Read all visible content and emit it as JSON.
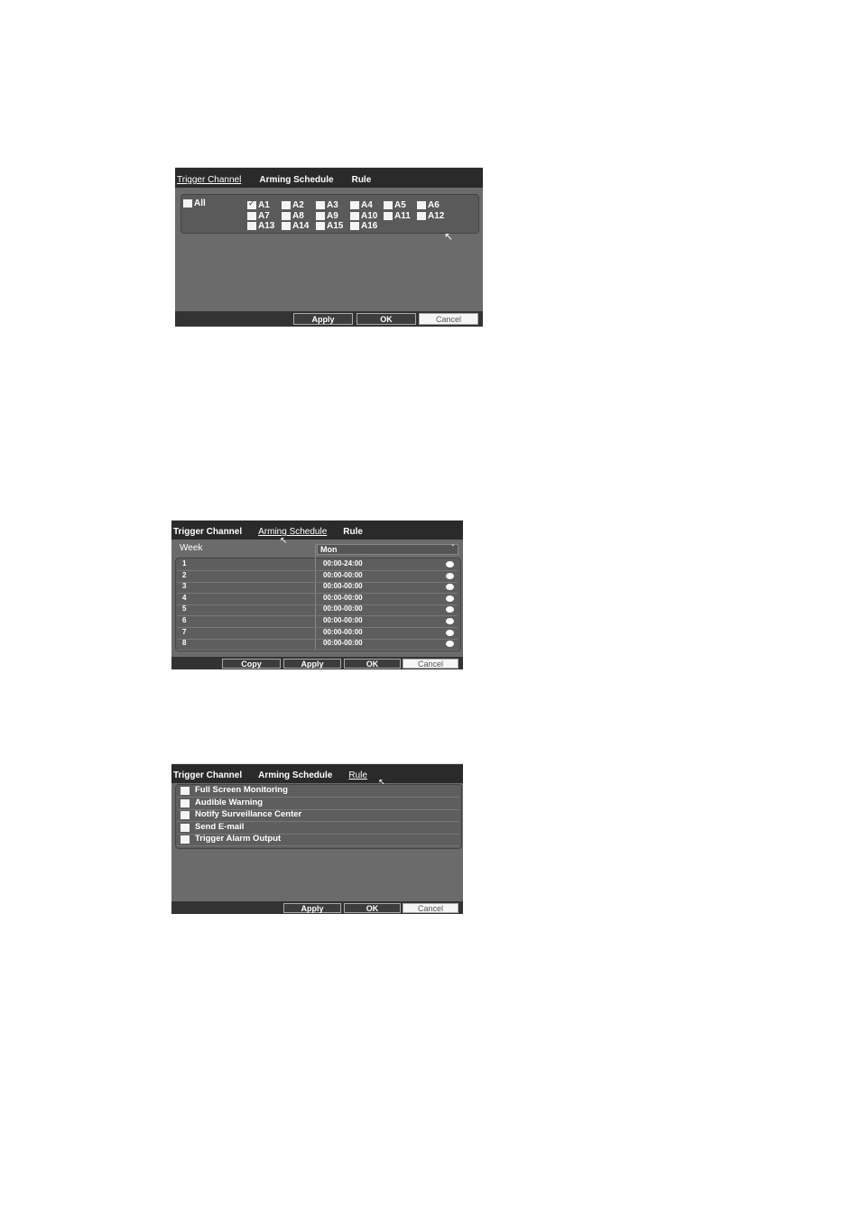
{
  "screenshot1": {
    "tabs": [
      "Trigger Channel",
      "Arming Schedule",
      "Rule"
    ],
    "all_label": "All",
    "channels": [
      {
        "label": "A1",
        "checked": true
      },
      {
        "label": "A2",
        "checked": false
      },
      {
        "label": "A3",
        "checked": false
      },
      {
        "label": "A4",
        "checked": false
      },
      {
        "label": "A5",
        "checked": false
      },
      {
        "label": "A6",
        "checked": false
      },
      {
        "label": "A7",
        "checked": false
      },
      {
        "label": "A8",
        "checked": false
      },
      {
        "label": "A9",
        "checked": false
      },
      {
        "label": "A10",
        "checked": false
      },
      {
        "label": "A11",
        "checked": false
      },
      {
        "label": "A12",
        "checked": false
      },
      {
        "label": "A13",
        "checked": false
      },
      {
        "label": "A14",
        "checked": false
      },
      {
        "label": "A15",
        "checked": false
      },
      {
        "label": "A16",
        "checked": false
      }
    ],
    "buttons": {
      "apply": "Apply",
      "ok": "OK",
      "cancel": "Cancel"
    }
  },
  "screenshot2": {
    "tabs": [
      "Trigger Channel",
      "Arming Schedule",
      "Rule"
    ],
    "week_label": "Week",
    "day_value": "Mon",
    "rows": [
      {
        "num": "1",
        "time": "00:00-24:00"
      },
      {
        "num": "2",
        "time": "00:00-00:00"
      },
      {
        "num": "3",
        "time": "00:00-00:00"
      },
      {
        "num": "4",
        "time": "00:00-00:00"
      },
      {
        "num": "5",
        "time": "00:00-00:00"
      },
      {
        "num": "6",
        "time": "00:00-00:00"
      },
      {
        "num": "7",
        "time": "00:00-00:00"
      },
      {
        "num": "8",
        "time": "00:00-00:00"
      }
    ],
    "buttons": {
      "copy": "Copy",
      "apply": "Apply",
      "ok": "OK",
      "cancel": "Cancel"
    }
  },
  "screenshot3": {
    "tabs": [
      "Trigger Channel",
      "Arming Schedule",
      "Rule"
    ],
    "rules": [
      "Full Screen Monitoring",
      "Audible Warning",
      "Notify Surveillance Center",
      "Send E-mail",
      "Trigger Alarm Output"
    ],
    "buttons": {
      "apply": "Apply",
      "ok": "OK",
      "cancel": "Cancel"
    }
  }
}
